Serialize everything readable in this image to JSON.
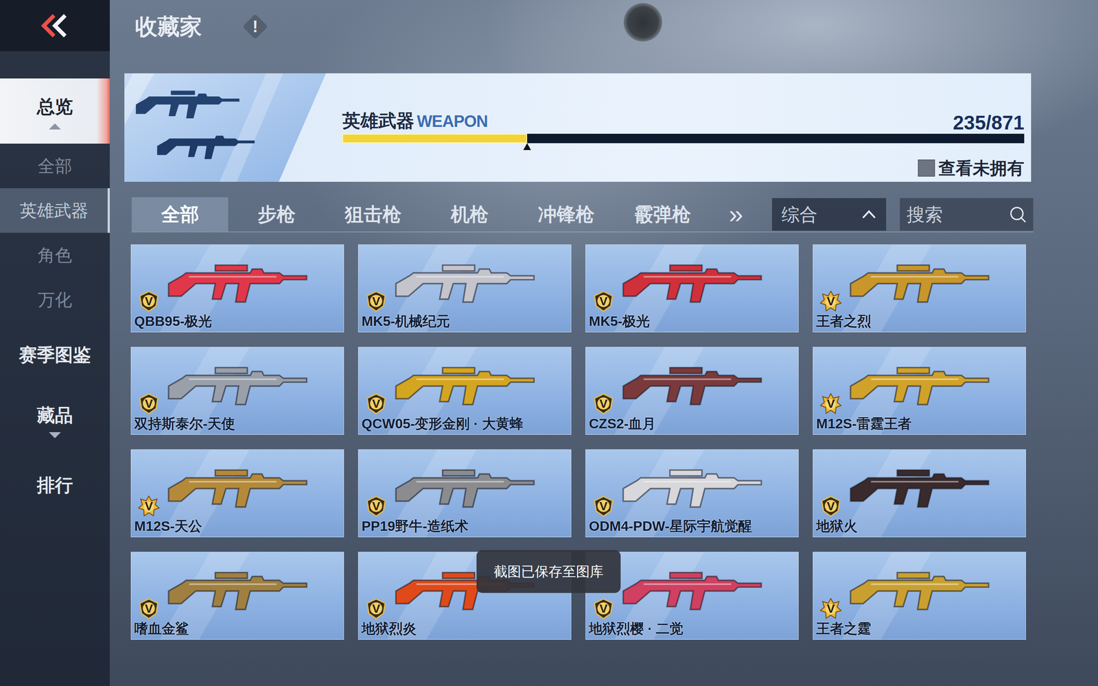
{
  "header": {
    "title": "收藏家",
    "info": "!"
  },
  "sidebar": {
    "items": [
      {
        "label": "总览",
        "kind": "group",
        "selected": true,
        "expanded": true
      },
      {
        "label": "全部",
        "kind": "sub",
        "selected": false
      },
      {
        "label": "英雄武器",
        "kind": "sub",
        "selected": true
      },
      {
        "label": "角色",
        "kind": "sub",
        "selected": false
      },
      {
        "label": "万化",
        "kind": "sub",
        "selected": false
      },
      {
        "label": "赛季图鉴",
        "kind": "link",
        "selected": false
      },
      {
        "label": "藏品",
        "kind": "group",
        "selected": false,
        "expanded": false
      },
      {
        "label": "排行",
        "kind": "link",
        "selected": false
      }
    ]
  },
  "banner": {
    "title": "英雄武器",
    "subtitle": "WEAPON",
    "count": "235/871",
    "level": 0.271,
    "show_unowned": {
      "label": "查看未拥有",
      "checked": false
    }
  },
  "tabs": [
    {
      "label": "全部",
      "selected": true
    },
    {
      "label": "步枪",
      "selected": false
    },
    {
      "label": "狙击枪",
      "selected": false
    },
    {
      "label": "机枪",
      "selected": false
    },
    {
      "label": "冲锋枪",
      "selected": false
    },
    {
      "label": "霰弹枪",
      "selected": false
    }
  ],
  "tabs_more": "»",
  "sort": {
    "label": "综合"
  },
  "search": {
    "placeholder": "搜索"
  },
  "weapons": [
    {
      "name": "QBB95-极光",
      "tier": "V",
      "kind": "legendary",
      "color": "#e0384a"
    },
    {
      "name": "MK5-机械纪元",
      "tier": "V",
      "kind": "legendary",
      "color": "#c4c4cc"
    },
    {
      "name": "MK5-极光",
      "tier": "V",
      "kind": "legendary",
      "color": "#d0303a"
    },
    {
      "name": "王者之烈",
      "tier": "V",
      "kind": "mythic",
      "color": "#c8962a"
    },
    {
      "name": "双持斯泰尔-天使",
      "tier": "V",
      "kind": "legendary",
      "color": "#9aa0aa"
    },
    {
      "name": "QCW05-变形金刚 · 大黄蜂",
      "tier": "V",
      "kind": "legendary",
      "color": "#d4a520"
    },
    {
      "name": "CZS2-血月",
      "tier": "V",
      "kind": "legendary",
      "color": "#7a3a3c"
    },
    {
      "name": "M12S-雷霆王者",
      "tier": "V",
      "kind": "mythic",
      "color": "#d1a22a"
    },
    {
      "name": "M12S-天公",
      "tier": "V",
      "kind": "mythic",
      "color": "#b48a3a"
    },
    {
      "name": "PP19野牛-造纸术",
      "tier": "V",
      "kind": "legendary",
      "color": "#8a8c90"
    },
    {
      "name": "ODM4-PDW-星际宇航觉醒",
      "tier": "V",
      "kind": "legendary",
      "color": "#d8d8dc"
    },
    {
      "name": "地狱火",
      "tier": "V",
      "kind": "legendary",
      "color": "#3a2a2c"
    },
    {
      "name": "嗜血金鲨",
      "tier": "V",
      "kind": "legendary",
      "color": "#a08040"
    },
    {
      "name": "地狱烈炎",
      "tier": "V",
      "kind": "legendary",
      "color": "#e04a1a"
    },
    {
      "name": "地狱烈樱 · 二觉",
      "tier": "V",
      "kind": "legendary",
      "color": "#d04060"
    },
    {
      "name": "王者之霆",
      "tier": "V",
      "kind": "mythic",
      "color": "#c9a030"
    }
  ],
  "toast": "截图已保存至图库"
}
